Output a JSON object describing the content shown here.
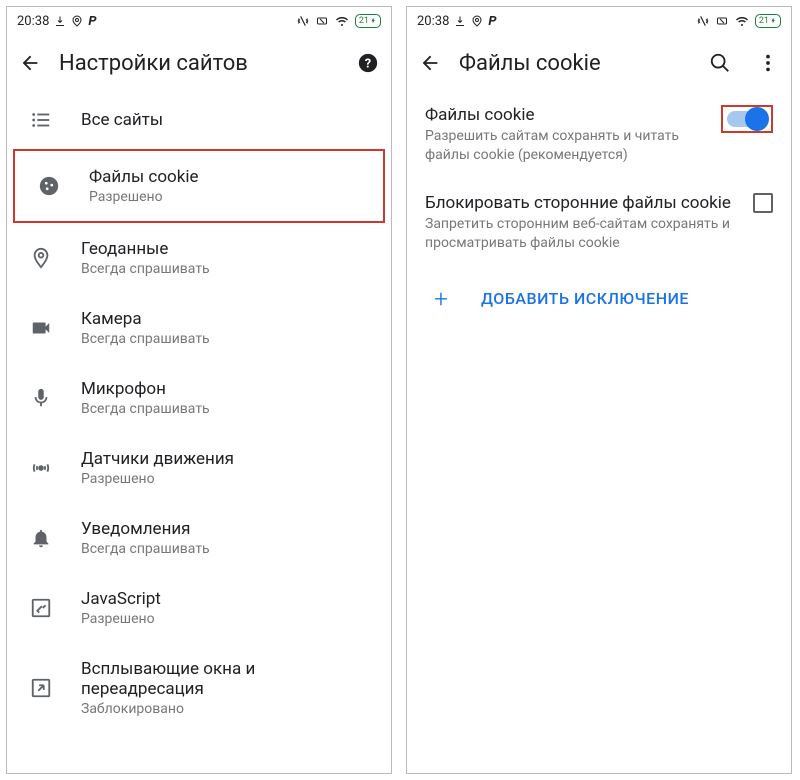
{
  "status": {
    "time": "20:38",
    "battery": "21"
  },
  "left": {
    "title": "Настройки сайтов",
    "items": [
      {
        "icon": "list",
        "label": "Все сайты",
        "sub": null
      },
      {
        "icon": "cookie",
        "label": "Файлы cookie",
        "sub": "Разрешено",
        "highlight": true
      },
      {
        "icon": "location",
        "label": "Геоданные",
        "sub": "Всегда спрашивать"
      },
      {
        "icon": "camera",
        "label": "Камера",
        "sub": "Всегда спрашивать"
      },
      {
        "icon": "mic",
        "label": "Микрофон",
        "sub": "Всегда спрашивать"
      },
      {
        "icon": "motion",
        "label": "Датчики движения",
        "sub": "Разрешено"
      },
      {
        "icon": "bell",
        "label": "Уведомления",
        "sub": "Всегда спрашивать"
      },
      {
        "icon": "js",
        "label": "JavaScript",
        "sub": "Разрешено"
      },
      {
        "icon": "popup",
        "label": "Всплывающие окна и переадресация",
        "sub": "Заблокировано"
      }
    ]
  },
  "right": {
    "title": "Файлы cookie",
    "toggle": {
      "label": "Файлы cookie",
      "sub": "Разрешить сайтам сохранять и читать файлы cookie (рекомендуется)",
      "on": true
    },
    "block": {
      "label": "Блокировать сторонние файлы cookie",
      "sub": "Запретить сторонним веб-сайтам сохранять и просматривать файлы cookie",
      "checked": false
    },
    "add": {
      "plus": "+",
      "label": "ДОБАВИТЬ ИСКЛЮЧЕНИЕ"
    }
  }
}
